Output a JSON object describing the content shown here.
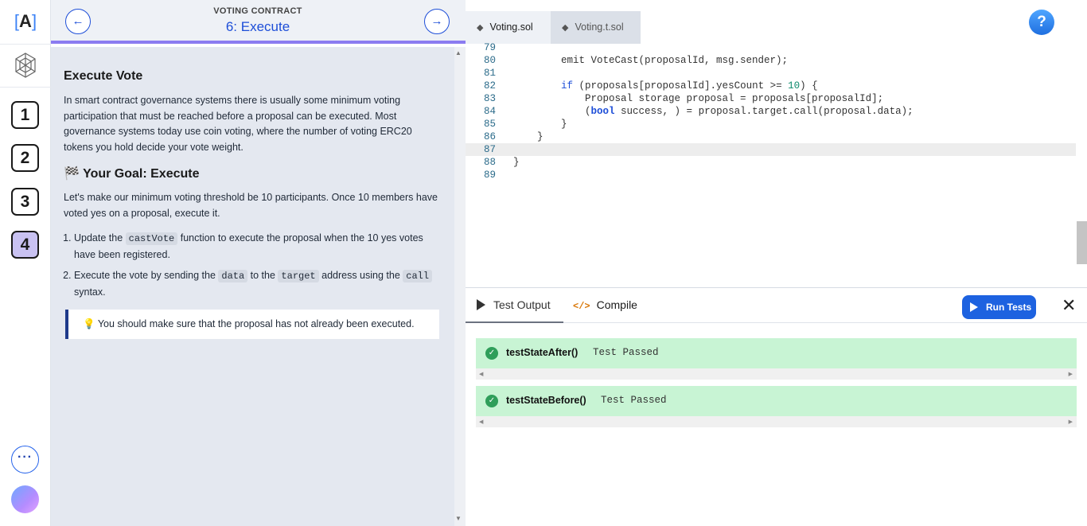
{
  "rail": {
    "logo_text": "A",
    "steps": [
      "1",
      "2",
      "3",
      "4"
    ],
    "more_label": "···"
  },
  "lesson_header": {
    "super": "VOTING CONTRACT",
    "title": "6: Execute",
    "prev_icon": "←",
    "next_icon": "→"
  },
  "lesson": {
    "heading": "Execute Vote",
    "intro": "In smart contract governance systems there is usually some minimum voting participation that must be reached before a proposal can be executed. Most governance systems today use coin voting, where the number of voting ERC20 tokens you hold decide your vote weight.",
    "goal_icon": "🏁",
    "goal_heading": "Your Goal: Execute",
    "goal_text": "Let's make our minimum voting threshold be 10 participants. Once 10 members have voted yes on a proposal, execute it.",
    "steps": [
      {
        "pre": "Update the ",
        "code": "castVote",
        "post": " function to execute the proposal when the 10 yes votes have been registered."
      },
      {
        "pre": "Execute the vote by sending the ",
        "code": "data",
        "mid": " to the ",
        "code2": "target",
        "post": " address using the ",
        "code3": "call",
        "post2": " syntax."
      }
    ],
    "tip_icon": "💡",
    "tip": "You should make sure that the proposal has not already been executed."
  },
  "editor": {
    "tabs": [
      {
        "label": "Voting.sol",
        "icon": "ethereum-icon"
      },
      {
        "label": "Voting.t.sol",
        "icon": "ethereum-icon"
      }
    ],
    "help_label": "?",
    "lines": [
      {
        "n": "79",
        "src": ""
      },
      {
        "n": "80",
        "src": "        emit VoteCast(proposalId, msg.sender);"
      },
      {
        "n": "81",
        "src": ""
      },
      {
        "n": "82",
        "pre": "        ",
        "kw": "if",
        "src": " (proposals[proposalId].yesCount >= ",
        "num": "10",
        "post": ") {"
      },
      {
        "n": "83",
        "src": "            Proposal storage proposal = proposals[proposalId];"
      },
      {
        "n": "84",
        "pre": "            (",
        "ty": "bool",
        "src": " success, ) = proposal.target.call(proposal.data);"
      },
      {
        "n": "85",
        "src": "        }"
      },
      {
        "n": "86",
        "src": "    }"
      },
      {
        "n": "87",
        "src": ""
      },
      {
        "n": "88",
        "src": "}"
      },
      {
        "n": "89",
        "src": ""
      }
    ]
  },
  "test_panel": {
    "output_tab": "Test Output",
    "compile_tab": "Compile",
    "compile_icon": "</>",
    "run_label": "Run Tests",
    "close_icon": "✕",
    "results": [
      {
        "name": "testStateAfter()",
        "status": "Test Passed"
      },
      {
        "name": "testStateBefore()",
        "status": "Test Passed"
      }
    ]
  },
  "colors": {
    "accent": "#1d62e0",
    "step_active": "#c9c2f2",
    "pass_bg": "#c8f4d4",
    "pass_check": "#2f9e5a"
  }
}
